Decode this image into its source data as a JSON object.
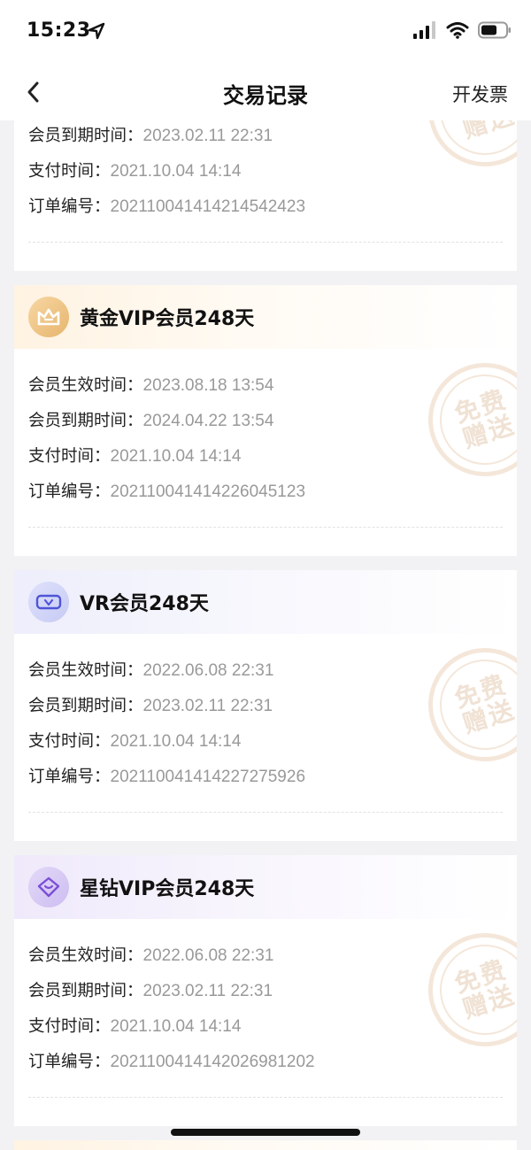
{
  "status_bar": {
    "time": "15:23",
    "icons": [
      "location-arrow-icon",
      "signal-icon",
      "wifi-icon",
      "battery-icon"
    ]
  },
  "nav": {
    "back_icon": "chevron-left-icon",
    "title": "交易记录",
    "right_action": "开发票"
  },
  "labels": {
    "start": "会员生效时间：",
    "end": "会员到期时间：",
    "paid": "支付时间：",
    "order": "订单编号："
  },
  "stamp_text": "免费赠送",
  "cards": [
    {
      "title": "",
      "end": "2023.02.11 22:31",
      "paid": "2021.10.04 14:14",
      "order": "202110041414214542423"
    },
    {
      "title": "黄金VIP会员248天",
      "icon": "crown-icon",
      "start": "2023.08.18 13:54",
      "end": "2024.04.22 13:54",
      "paid": "2021.10.04 14:14",
      "order": "202110041414226045123"
    },
    {
      "title": "VR会员248天",
      "icon": "vr-goggles-icon",
      "start": "2022.06.08 22:31",
      "end": "2023.02.11 22:31",
      "paid": "2021.10.04 14:14",
      "order": "202110041414227275926"
    },
    {
      "title": "星钻VIP会员248天",
      "icon": "diamond-icon",
      "start": "2022.06.08 22:31",
      "end": "2023.02.11 22:31",
      "paid": "2021.10.04 14:14",
      "order": "202110041414202698120​2"
    }
  ],
  "colors": {
    "background": "#f2f2f4",
    "value_text": "#999999",
    "gold_accent": "#e7b56d",
    "vr_accent": "#5b5fd6",
    "star_accent": "#7b4fd6"
  }
}
